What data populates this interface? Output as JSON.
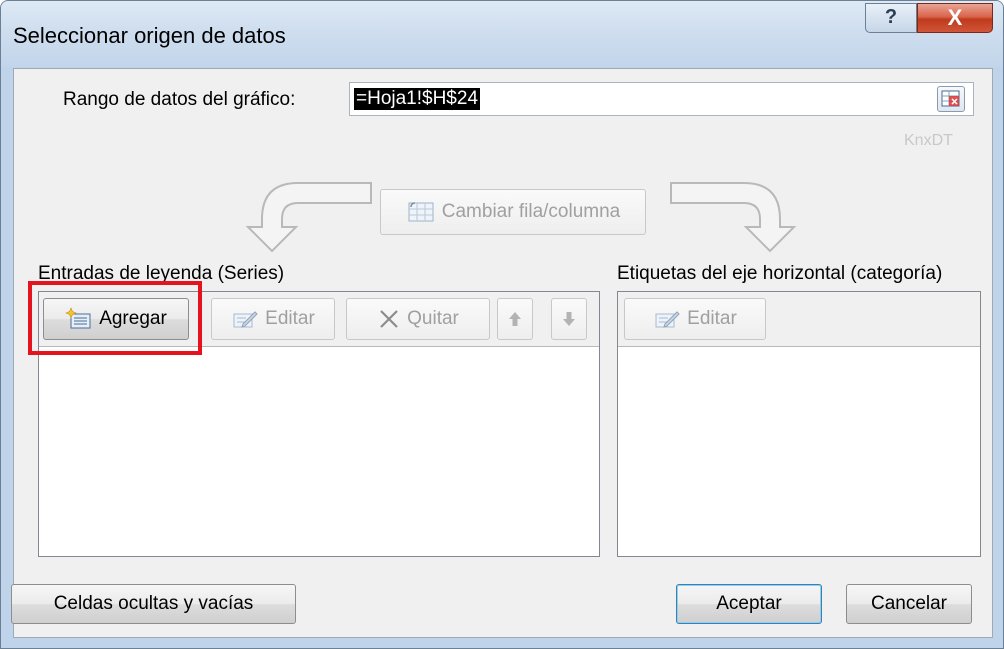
{
  "window": {
    "title": "Seleccionar origen de datos",
    "help_label": "?",
    "close_label": "X"
  },
  "range": {
    "label": "Rango de datos del gráfico:",
    "value": "=Hoja1!$H$24",
    "watermark": "KnxDT"
  },
  "switch_button": {
    "label": "Cambiar fila/columna"
  },
  "legend_entries": {
    "heading": "Entradas de leyenda (Series)",
    "add_label": "Agregar",
    "edit_label": "Editar",
    "remove_label": "Quitar",
    "items": []
  },
  "axis_labels": {
    "heading": "Etiquetas del eje horizontal (categoría)",
    "edit_label": "Editar",
    "items": []
  },
  "footer": {
    "hidden_cells_label": "Celdas ocultas y vacías",
    "ok_label": "Aceptar",
    "cancel_label": "Cancelar"
  },
  "colors": {
    "highlight": "#e5131d",
    "selection": "#000000"
  }
}
